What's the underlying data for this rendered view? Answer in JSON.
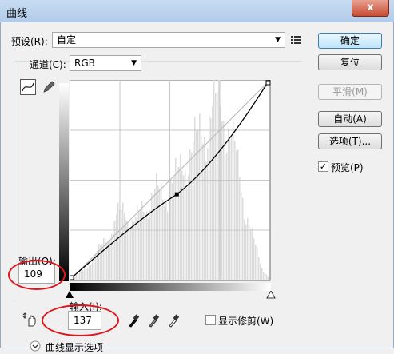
{
  "window": {
    "title": "曲线",
    "close_glyph": "x"
  },
  "preset": {
    "label": "预设(R):",
    "value": "自定"
  },
  "channel": {
    "label": "通道(C):",
    "value": "RGB"
  },
  "buttons": {
    "ok": "确定",
    "reset": "复位",
    "smooth": "平滑(M)",
    "auto": "自动(A)",
    "options": "选项(T)...",
    "preview": "预览(P)"
  },
  "preview_checked": true,
  "output": {
    "label": "输出(O):",
    "value": "109"
  },
  "input": {
    "label": "输入(I):",
    "value": "137"
  },
  "show_clipping": {
    "label": "显示修剪(W)",
    "checked": false
  },
  "curve_display_options": {
    "label": "曲线显示选项"
  },
  "curve_point": {
    "input": 137,
    "output": 109
  },
  "colors": {
    "accent": "#e0141b",
    "default_button": "#3c7fb1"
  }
}
